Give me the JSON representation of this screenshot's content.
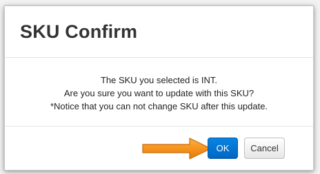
{
  "dialog": {
    "title": "SKU Confirm",
    "body_lines": [
      "The SKU you selected is INT.",
      "Are you sure you want to update with this SKU?",
      "*Notice that you can not change SKU after this update."
    ],
    "ok_label": "OK",
    "cancel_label": "Cancel"
  },
  "colors": {
    "ok_button": "#0a77d6",
    "annotation_arrow": "#f7941d"
  },
  "icons": [
    "annotation-arrow-icon"
  ]
}
